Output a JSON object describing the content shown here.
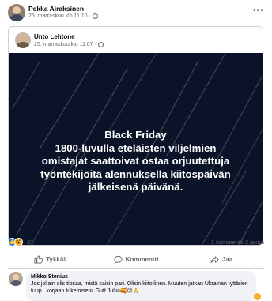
{
  "post": {
    "author": "Pekka Airaksinen",
    "timestamp": "25. marraskuu klo 11.10",
    "privacy_icon": "globe-icon",
    "more_label": "···"
  },
  "shared": {
    "author": "Unto Lehtone",
    "timestamp": "25. marraskuu klo 11.07",
    "privacy_icon": "globe-icon"
  },
  "image": {
    "background": "#0b1329",
    "lines": [
      "Black Friday",
      "1800-luvulla eteläisten viljelmien",
      "omistajat saattoivat ostaa orjuutettuja",
      "työntekijöitä alennuksella kiitospäivän",
      "jälkeisenä päivänä."
    ]
  },
  "stats": {
    "reaction_count": "21",
    "reactions": [
      "like",
      "wow"
    ],
    "comments": "1 kommentti",
    "shares": "3 jakoa"
  },
  "actions": [
    {
      "label": "Tykkää",
      "icon": "thumbs-up-icon"
    },
    {
      "label": "Kommentti",
      "icon": "comment-icon"
    },
    {
      "label": "Jaa",
      "icon": "share-icon"
    }
  ],
  "comment": {
    "author": "Mikko Stenius",
    "text": "Jos jollain olis tipsaa, mistä saisin pari. Olisin kiitollinen. Muuten jatkan Ukrainan tyttärien tuup.. korjaan tukemiseni. Gutt Jullia🥰😉🙏"
  },
  "colors": {
    "accent": "#1877f2",
    "meta_text": "#65676b",
    "divider": "#ced0d4",
    "comment_bg": "#f0f2f5"
  }
}
